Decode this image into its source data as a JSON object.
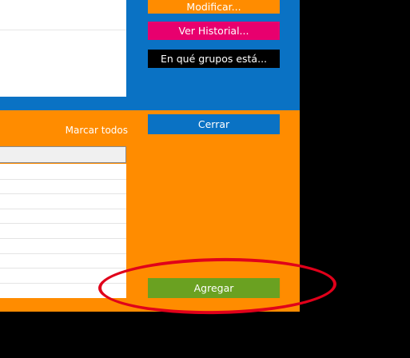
{
  "right_panel": {
    "modify_label": "Modificar...",
    "history_label": "Ver Historial...",
    "groups_label": "En qué grupos está...",
    "close_label": "Cerrar",
    "add_label": "Agregar"
  },
  "list": {
    "mark_all_label": "Marcar todos"
  },
  "colors": {
    "blue": "#0a72c4",
    "orange": "#ff8c00",
    "pink": "#e8006e",
    "green": "#6aa121",
    "annotation_red": "#e0001a"
  }
}
